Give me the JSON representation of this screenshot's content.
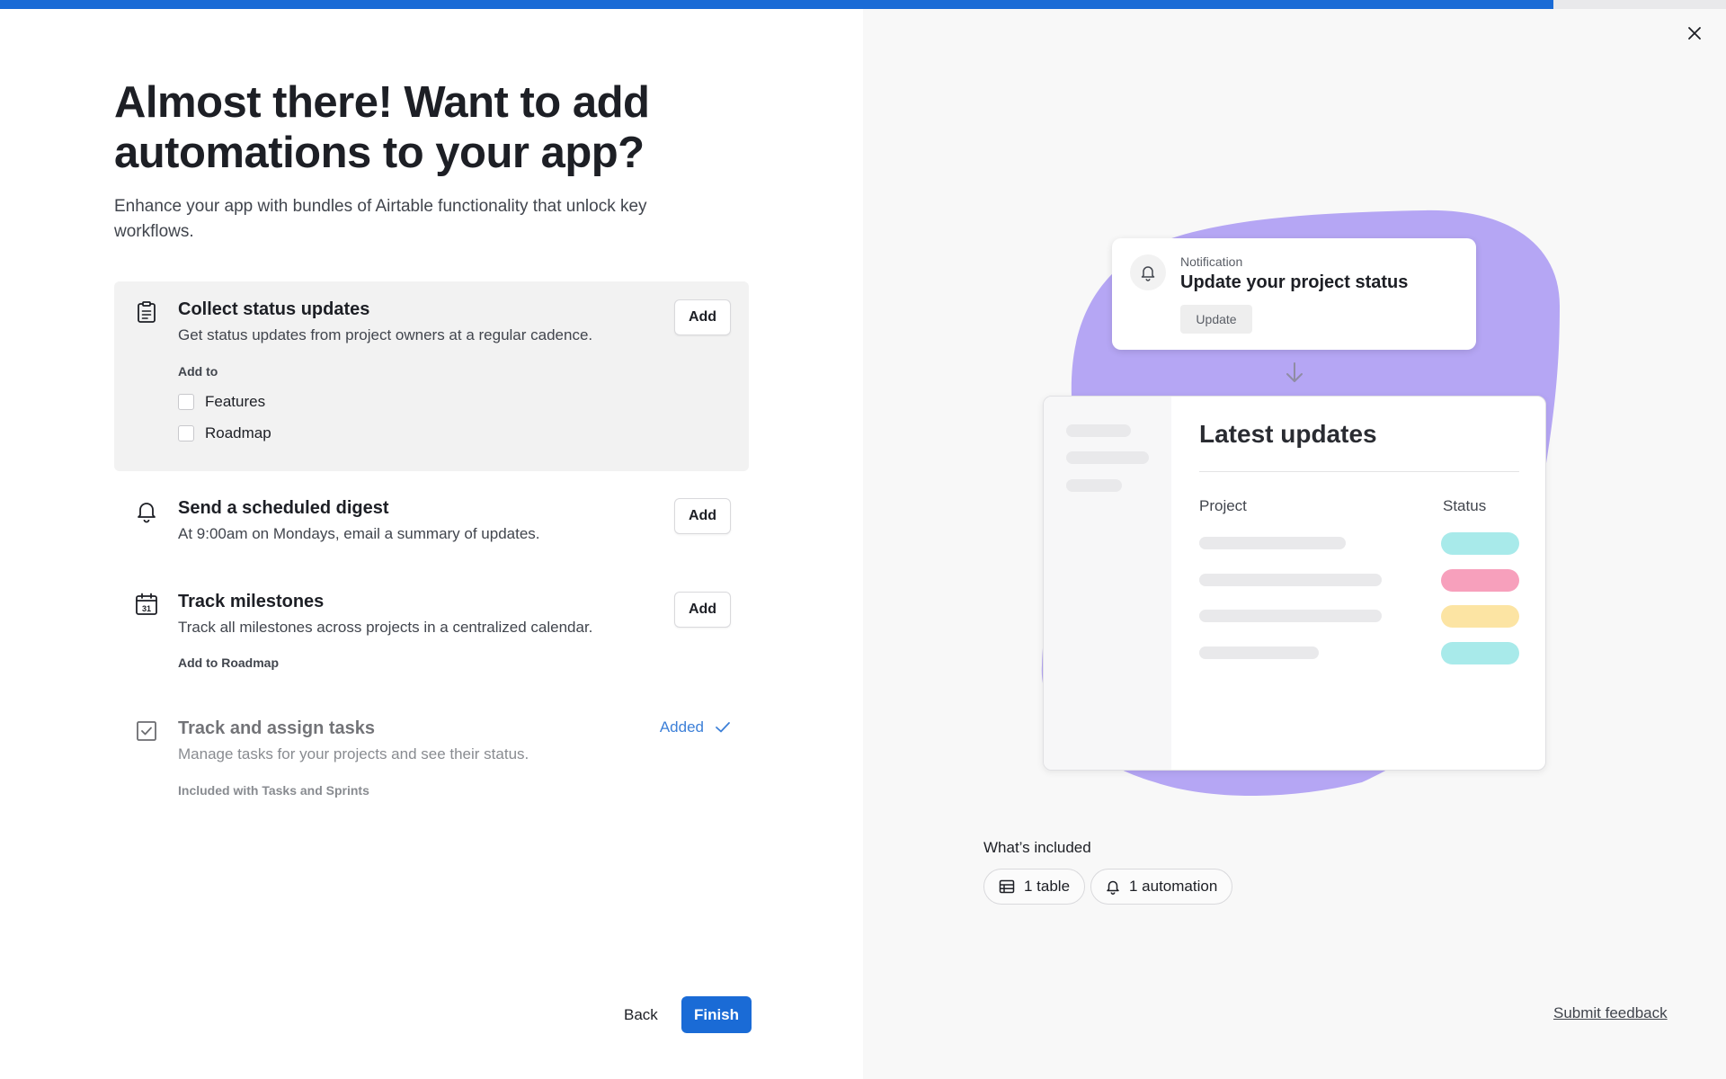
{
  "progress": {
    "percent": 90
  },
  "colors": {
    "accent": "#1a6bd6",
    "blob": "#b5a6f4",
    "added": "#3d80d8"
  },
  "header": {
    "title": "Almost there! Want to add automations to your app?",
    "subtitle": "Enhance your app with bundles of Airtable functionality that unlock key workflows."
  },
  "automations": [
    {
      "title": "Collect status updates",
      "description": "Get status updates from project owners at a regular cadence.",
      "add_label": "Add",
      "add_to_label": "Add to",
      "options": [
        "Features",
        "Roadmap"
      ],
      "icon": "clipboard-icon"
    },
    {
      "title": "Send a scheduled digest",
      "description": "At 9:00am on Mondays, email a summary of updates.",
      "add_label": "Add",
      "icon": "bell-icon"
    },
    {
      "title": "Track milestones",
      "description": "Track all milestones across projects in a centralized calendar.",
      "add_label": "Add",
      "note": "Add to Roadmap",
      "icon": "calendar-icon",
      "icon_day": "31"
    },
    {
      "title": "Track and assign tasks",
      "description": "Manage tasks for your projects and see their status.",
      "status_label": "Added",
      "note": "Included with Tasks and Sprints",
      "icon": "checkbox-icon"
    }
  ],
  "footer": {
    "back_label": "Back",
    "finish_label": "Finish"
  },
  "preview": {
    "notification": {
      "type_label": "Notification",
      "title": "Update your project status",
      "button_label": "Update"
    },
    "updates_card": {
      "title": "Latest updates",
      "col_project": "Project",
      "col_status": "Status",
      "status_colors": [
        "#a8eaea",
        "#f7a0bc",
        "#fce4a3",
        "#a8eaea"
      ]
    }
  },
  "whats_included": {
    "label": "What’s included",
    "items": [
      {
        "label": "1 table",
        "icon": "table-icon"
      },
      {
        "label": "1 automation",
        "icon": "bell-icon"
      }
    ]
  },
  "feedback": {
    "label": "Submit feedback"
  }
}
